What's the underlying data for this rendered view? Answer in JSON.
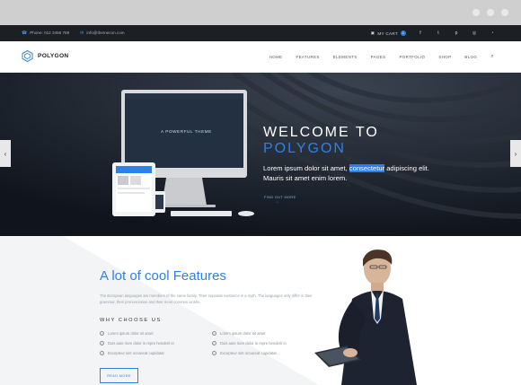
{
  "topbar": {
    "phone": "Phone: 012 3456 789",
    "email": "info@themecon.com",
    "cart_label": "MY CART",
    "cart_count": "1"
  },
  "nav": {
    "logo_text": "POLYGON",
    "items": [
      "HOME",
      "FEATURES",
      "ELEMENTS",
      "PAGES",
      "PORTFOLIO",
      "SHOP",
      "BLOG"
    ]
  },
  "hero": {
    "title_line1": "WELCOME TO",
    "title_line2": "POLYGON",
    "text_before": "Lorem ipsum dolor sit amet, ",
    "text_highlight": "consectetur",
    "text_after": " adipiscing elit. Mauris sit amet enim lorem.",
    "find_more": "FIND OUT MORE",
    "screen_caption": "A POWERFUL THEME"
  },
  "features": {
    "title": "A lot of cool Features",
    "description": "The European languages are members of the same family. Their separate existence is a myth. The languages only differ in their grammar, their pronunciation and their most common words.",
    "why_choose": "WHY CHOOSE US",
    "list_left": [
      "Lorem ipsum dolor sit amet",
      "Duis aute irure dolor in repre henderit in",
      "Excepteur sint occaecat cupidatat"
    ],
    "list_right": [
      "Lorem ipsum dolor sit amet",
      "Duis aute irure dolor in repre henderit in",
      "Excepteur sint occaecat cupidatat"
    ],
    "read_more": "READ MORE"
  },
  "colors": {
    "accent": "#2f80e4",
    "topbar": "#1c1f24",
    "hero_bg": "#121821"
  }
}
